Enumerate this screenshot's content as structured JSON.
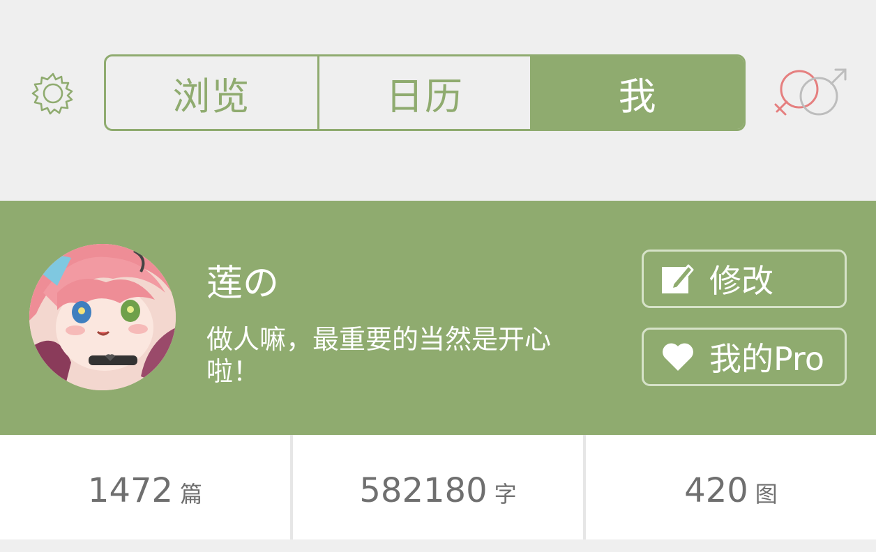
{
  "header": {
    "tabs": [
      {
        "label": "浏览",
        "active": false
      },
      {
        "label": "日历",
        "active": false
      },
      {
        "label": "我",
        "active": true
      }
    ],
    "icons": {
      "settings": "gear-icon",
      "gender": "gender-icon"
    },
    "colors": {
      "accent": "#8fab6f",
      "female": "#e57f7f",
      "male": "#bdbdbd"
    }
  },
  "profile": {
    "name": "莲の",
    "bio": "做人嘛，最重要的当然是开心啦！",
    "edit_label": "修改",
    "pro_label": "我的Pro"
  },
  "stats": [
    {
      "value": "1472",
      "unit": "篇"
    },
    {
      "value": "582180",
      "unit": "字"
    },
    {
      "value": "420",
      "unit": "图"
    }
  ]
}
